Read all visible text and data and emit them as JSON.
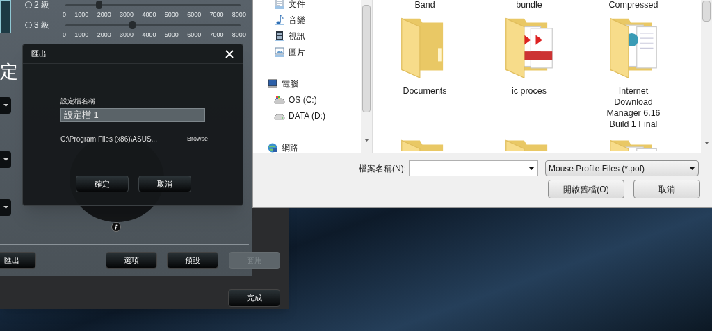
{
  "settings_window": {
    "dpi_rows": [
      {
        "label": "2 級",
        "selected": false,
        "level": 0.19,
        "tick_labels": [
          "0",
          "1000",
          "2000",
          "3000",
          "4000",
          "5000",
          "6000",
          "7000",
          "8000"
        ]
      },
      {
        "label": "3 級",
        "selected": false,
        "level": 0.38,
        "tick_labels": [
          "0",
          "1000",
          "2000",
          "3000",
          "4000",
          "5000",
          "6000",
          "7000",
          "8000"
        ]
      }
    ],
    "heading_fragment": "定",
    "buttons": [
      {
        "label": "匯出",
        "disabled": false
      },
      {
        "label": "選項",
        "disabled": false
      },
      {
        "label": "預設",
        "disabled": false
      },
      {
        "label": "套用",
        "disabled": true
      }
    ],
    "done_button": "完成"
  },
  "export_dialog": {
    "title": "匯出",
    "field_label": "設定檔名稱",
    "profile_name": "設定檔 1",
    "path": "C:\\Program Files (x86)\\ASUS...",
    "browse_link": "Browse",
    "buttons": [
      "確定",
      "取消"
    ]
  },
  "file_dialog": {
    "nav_items": [
      {
        "label": "文件",
        "kind": "documents"
      },
      {
        "label": "音樂",
        "kind": "music"
      },
      {
        "label": "視訊",
        "kind": "video"
      },
      {
        "label": "圖片",
        "kind": "pictures"
      },
      {
        "label": "電腦",
        "kind": "computer",
        "children": [
          {
            "label": "OS (C:)",
            "kind": "system-drive"
          },
          {
            "label": "DATA (D:)",
            "kind": "drive"
          }
        ]
      },
      {
        "label": "網路",
        "kind": "network"
      }
    ],
    "files": [
      {
        "name": "Band"
      },
      {
        "name": "bundle"
      },
      {
        "name": "Compressed"
      },
      {
        "name": "Documents",
        "kind": "folder"
      },
      {
        "name": "ic proces",
        "kind": "pdf-folder"
      },
      {
        "name": "Internet Download Manager 6.16 Build 1 Final",
        "kind": "document-folder"
      },
      {
        "kind": "folder"
      },
      {
        "kind": "folder"
      },
      {
        "kind": "document-folder"
      }
    ],
    "filename_label": "檔案名稱(N):",
    "file_type": "Mouse Profile Files (*.pof)",
    "buttons": [
      "開啟舊檔(O)",
      "取消"
    ]
  }
}
